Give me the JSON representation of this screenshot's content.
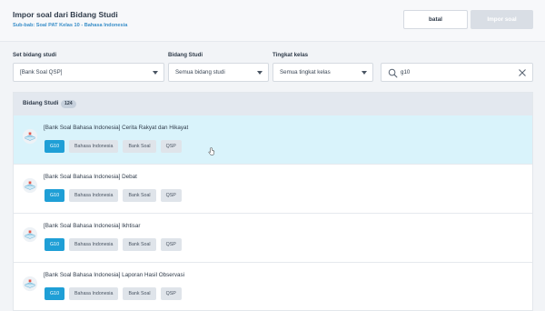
{
  "header": {
    "title": "Impor soal dari Bidang Studi",
    "subtitle": "Sub-bab: Soal PAT Kelas 10 - Bahasa Indonesia",
    "cancel_label": "batal",
    "import_label": "Impor soal"
  },
  "filters": {
    "set_label": "Set bidang studi",
    "set_value": "[Bank Soal QSP]",
    "bidang_label": "Bidang Studi",
    "bidang_value": "Semua bidang studi",
    "tingkat_label": "Tingkat kelas",
    "tingkat_value": "Semua tingkat kelas",
    "search_value": "g10"
  },
  "list": {
    "header_title": "Bidang Studi",
    "count": "124",
    "items": [
      {
        "title": "[Bank Soal Bahasa Indonesia] Cerita Rakyat dan Hikayat",
        "tags": [
          "G10",
          "Bahasa Indonesia",
          "Bank Soal",
          "QSP"
        ]
      },
      {
        "title": "[Bank Soal Bahasa Indonesia] Debat",
        "tags": [
          "G10",
          "Bahasa Indonesia",
          "Bank Soal",
          "QSP"
        ]
      },
      {
        "title": "[Bank Soal Bahasa Indonesia] Ikhtisar",
        "tags": [
          "G10",
          "Bahasa Indonesia",
          "Bank Soal",
          "QSP"
        ]
      },
      {
        "title": "[Bank Soal Bahasa Indonesia] Laporan Hasil Observasi",
        "tags": [
          "G10",
          "Bahasa Indonesia",
          "Bank Soal",
          "QSP"
        ]
      }
    ]
  },
  "colors": {
    "accent": "#1f9fd6",
    "hover_row": "#d9f3fb",
    "subtitle": "#3a8fc9"
  },
  "icons": [
    "chevron-down-icon",
    "search-icon",
    "close-icon",
    "book-icon",
    "cursor-icon"
  ]
}
